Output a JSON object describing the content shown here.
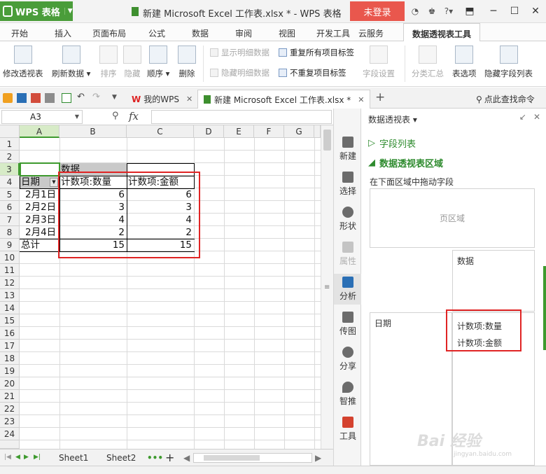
{
  "app": {
    "name": "WPS 表格",
    "window_title": "新建 Microsoft Excel 工作表.xlsx * - WPS 表格",
    "login": "未登录"
  },
  "menu": {
    "tabs": [
      "开始",
      "插入",
      "页面布局",
      "公式",
      "数据",
      "审阅",
      "视图",
      "开发工具",
      "云服务",
      "数据透视表工具"
    ]
  },
  "ribbon": {
    "modify_pivot": "修改透视表",
    "refresh": "刷新数据",
    "sort": "排序",
    "hide": "隐藏",
    "order": "顺序",
    "delete": "删除",
    "show_detail": "显示明细数据",
    "hide_detail": "隐藏明细数据",
    "repeat_all": "重复所有项目标签",
    "no_repeat": "不重复项目标签",
    "field_settings": "字段设置",
    "subtotal": "分类汇总",
    "table_options": "表选项",
    "hide_field_list": "隐藏字段列表"
  },
  "quick_access": {
    "my_wps": "我的WPS",
    "doc_tab": "新建 Microsoft Excel 工作表.xlsx *",
    "find_command": "点此查找命令"
  },
  "formula_bar": {
    "name_box": "A3",
    "fx": "fx",
    "value": ""
  },
  "grid": {
    "columns": [
      "A",
      "B",
      "C",
      "D",
      "E",
      "F",
      "G"
    ],
    "rows": [
      "1",
      "2",
      "3",
      "4",
      "5",
      "6",
      "7",
      "8",
      "9",
      "10",
      "11",
      "12",
      "13",
      "14",
      "15",
      "16",
      "17",
      "18",
      "19",
      "20",
      "21",
      "22",
      "23",
      "24"
    ],
    "b3": "数据",
    "headers": [
      "日期",
      "计数项:数量",
      "计数项:金额"
    ],
    "data_rows": [
      [
        "2月1日",
        "6",
        "6"
      ],
      [
        "2月2日",
        "3",
        "3"
      ],
      [
        "2月3日",
        "4",
        "4"
      ],
      [
        "2月4日",
        "2",
        "2"
      ],
      [
        "总计",
        "15",
        "15"
      ]
    ]
  },
  "sheets": {
    "tabs": [
      "Sheet1",
      "Sheet2"
    ],
    "more": "•••",
    "add": "+"
  },
  "sidebar": {
    "items": [
      "新建",
      "选择",
      "形状",
      "属性",
      "分析",
      "传图",
      "分享",
      "智推",
      "工具"
    ]
  },
  "pivot_panel": {
    "title": "数据透视表",
    "field_list": "字段列表",
    "area_title": "数据透视表区域",
    "hint": "在下面区域中拖动字段",
    "page_zone": "页区域",
    "column_zone": "数据",
    "row_zone": "日期",
    "value_fields": [
      "计数项:数量",
      "计数项:金额"
    ]
  },
  "watermark": {
    "text": "Bai 经验",
    "sub": "jingyan.baidu.com"
  }
}
